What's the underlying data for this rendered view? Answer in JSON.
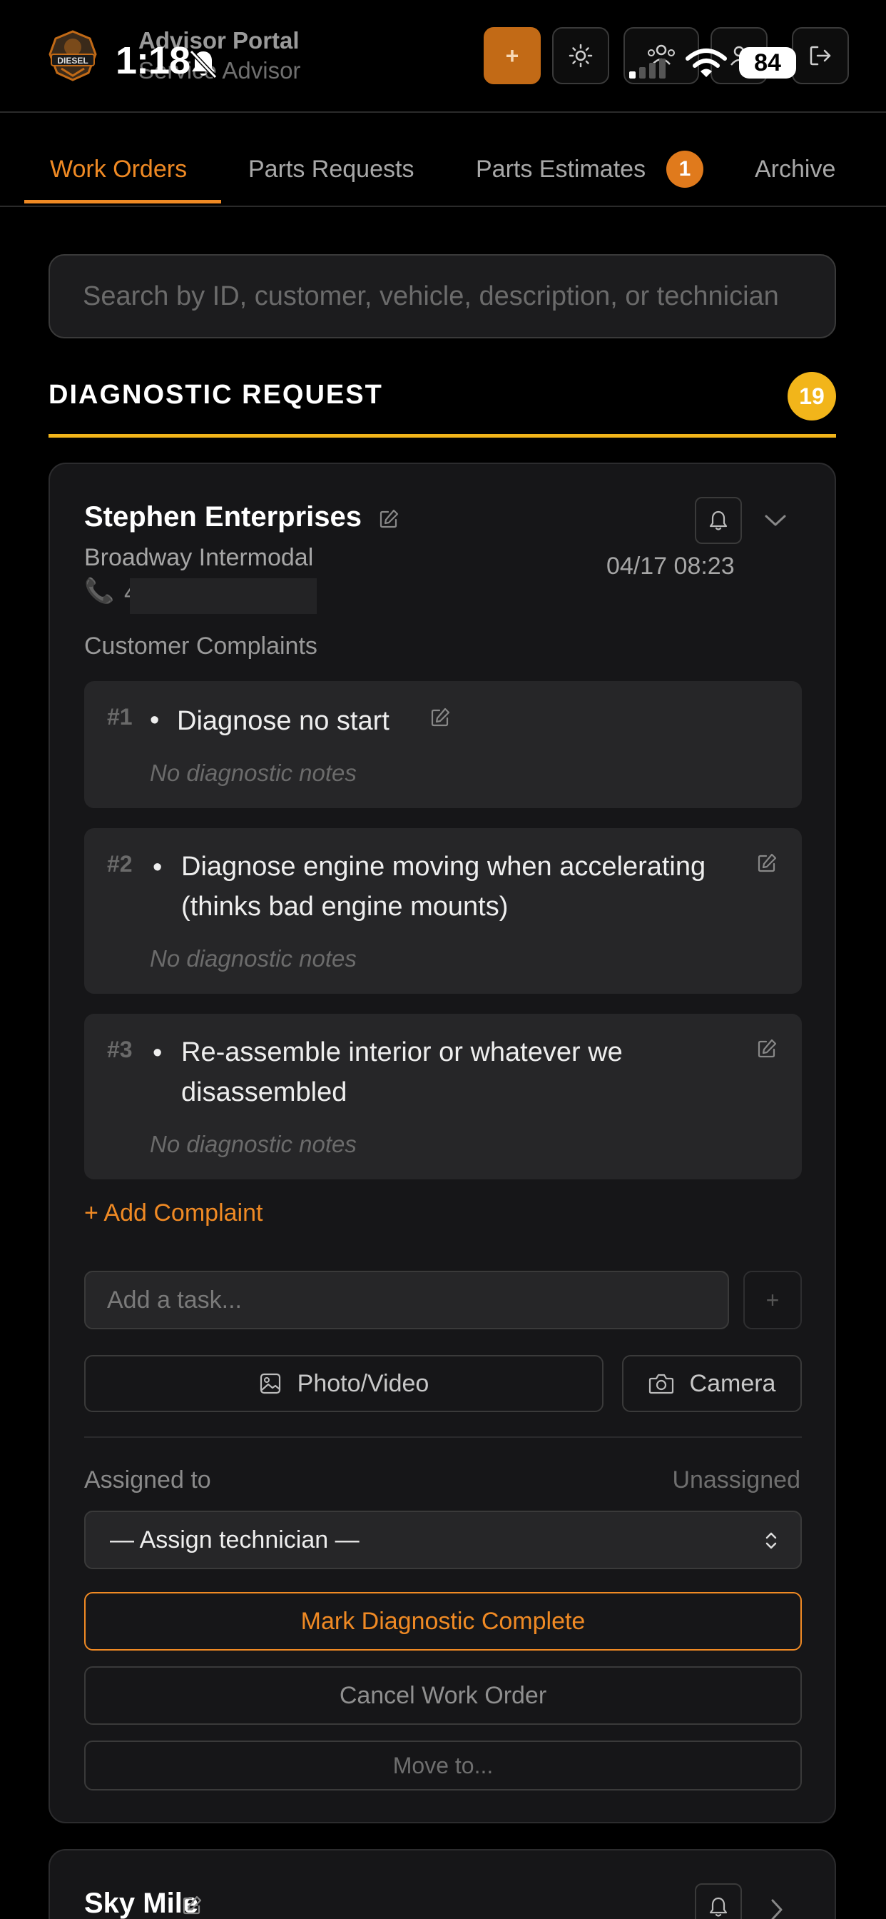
{
  "status_bar": {
    "time": "1:18",
    "battery": "84"
  },
  "header": {
    "title": "Advisor Portal",
    "subtitle": "Service Advisor",
    "add_label": "+",
    "logo_text": "DIESEL"
  },
  "tabs": [
    {
      "label": "Work Orders",
      "active": true
    },
    {
      "label": "Parts Requests",
      "active": false
    },
    {
      "label": "Parts Estimates",
      "active": false,
      "badge": "1"
    },
    {
      "label": "Archive",
      "active": false
    }
  ],
  "search": {
    "placeholder": "Search by ID, customer, vehicle, description, or technician"
  },
  "section": {
    "title": "DIAGNOSTIC REQUEST",
    "count": "19"
  },
  "work_order": {
    "customer": "Stephen Enterprises",
    "location": "Broadway Intermodal",
    "phone_icon": "📞",
    "phone": "4",
    "date": "04/17 08:23",
    "complaints_label": "Customer Complaints",
    "complaints": [
      {
        "num": "#1",
        "text": "Diagnose no start",
        "notes": "No diagnostic notes"
      },
      {
        "num": "#2",
        "text": "Diagnose engine moving when accelerating (thinks bad engine mounts)",
        "notes": "No diagnostic notes"
      },
      {
        "num": "#3",
        "text": "Re-assemble interior or whatever we disassembled",
        "notes": "No diagnostic notes"
      }
    ],
    "add_complaint_label": "+ Add Complaint",
    "task_placeholder": "Add a task...",
    "task_add_label": "+",
    "photo_label": "Photo/Video",
    "camera_label": "Camera",
    "assigned_label": "Assigned to",
    "assigned_value": "Unassigned",
    "assign_select": "— Assign technician —",
    "complete_label": "Mark Diagnostic Complete",
    "cancel_label": "Cancel Work Order",
    "move_label": "Move to..."
  },
  "next_order": {
    "customer": "Sky Mile"
  },
  "colors": {
    "accent": "#f08a24",
    "section_accent": "#f2b51a",
    "background": "#000000",
    "card": "#161618"
  }
}
